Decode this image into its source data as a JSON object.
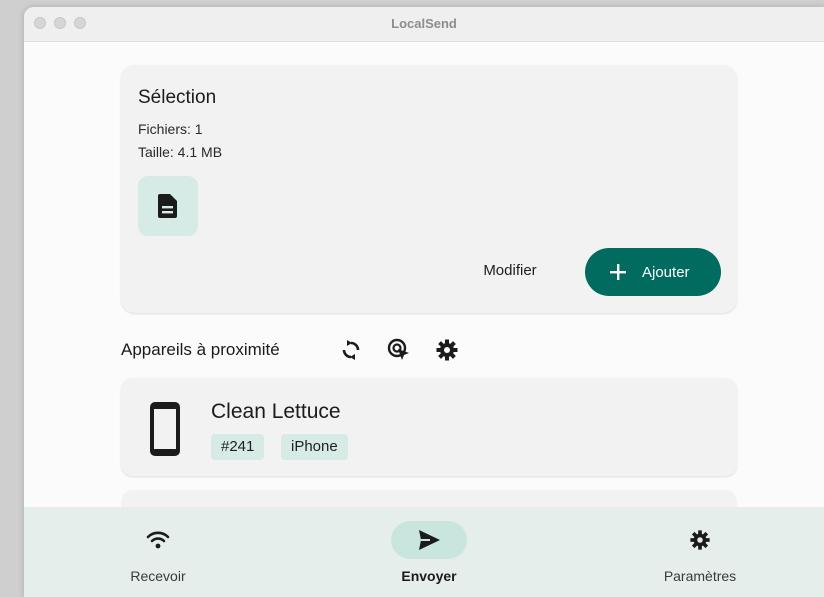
{
  "window": {
    "title": "LocalSend"
  },
  "selection": {
    "title": "Sélection",
    "files": "Fichiers: 1",
    "size": "Taille: 4.1 MB",
    "file_icon": "document-icon",
    "modify_label": "Modifier",
    "add_label": "Ajouter"
  },
  "nearby": {
    "title": "Appareils à proximité",
    "actions": [
      "refresh-icon",
      "target-cursor-icon",
      "gear-icon"
    ],
    "devices": [
      {
        "name": "Clean Lettuce",
        "id_tag": "#241",
        "type_tag": "iPhone",
        "icon": "smartphone-icon"
      }
    ]
  },
  "bottom_nav": {
    "items": [
      {
        "label": "Recevoir",
        "icon": "wifi-icon",
        "active": false
      },
      {
        "label": "Envoyer",
        "icon": "send-icon",
        "active": true
      },
      {
        "label": "Paramètres",
        "icon": "gear-icon",
        "active": false
      }
    ]
  },
  "colors": {
    "accent": "#006b5e",
    "accent_container": "#d6ebe6",
    "nav_background": "#e5eeeb"
  }
}
